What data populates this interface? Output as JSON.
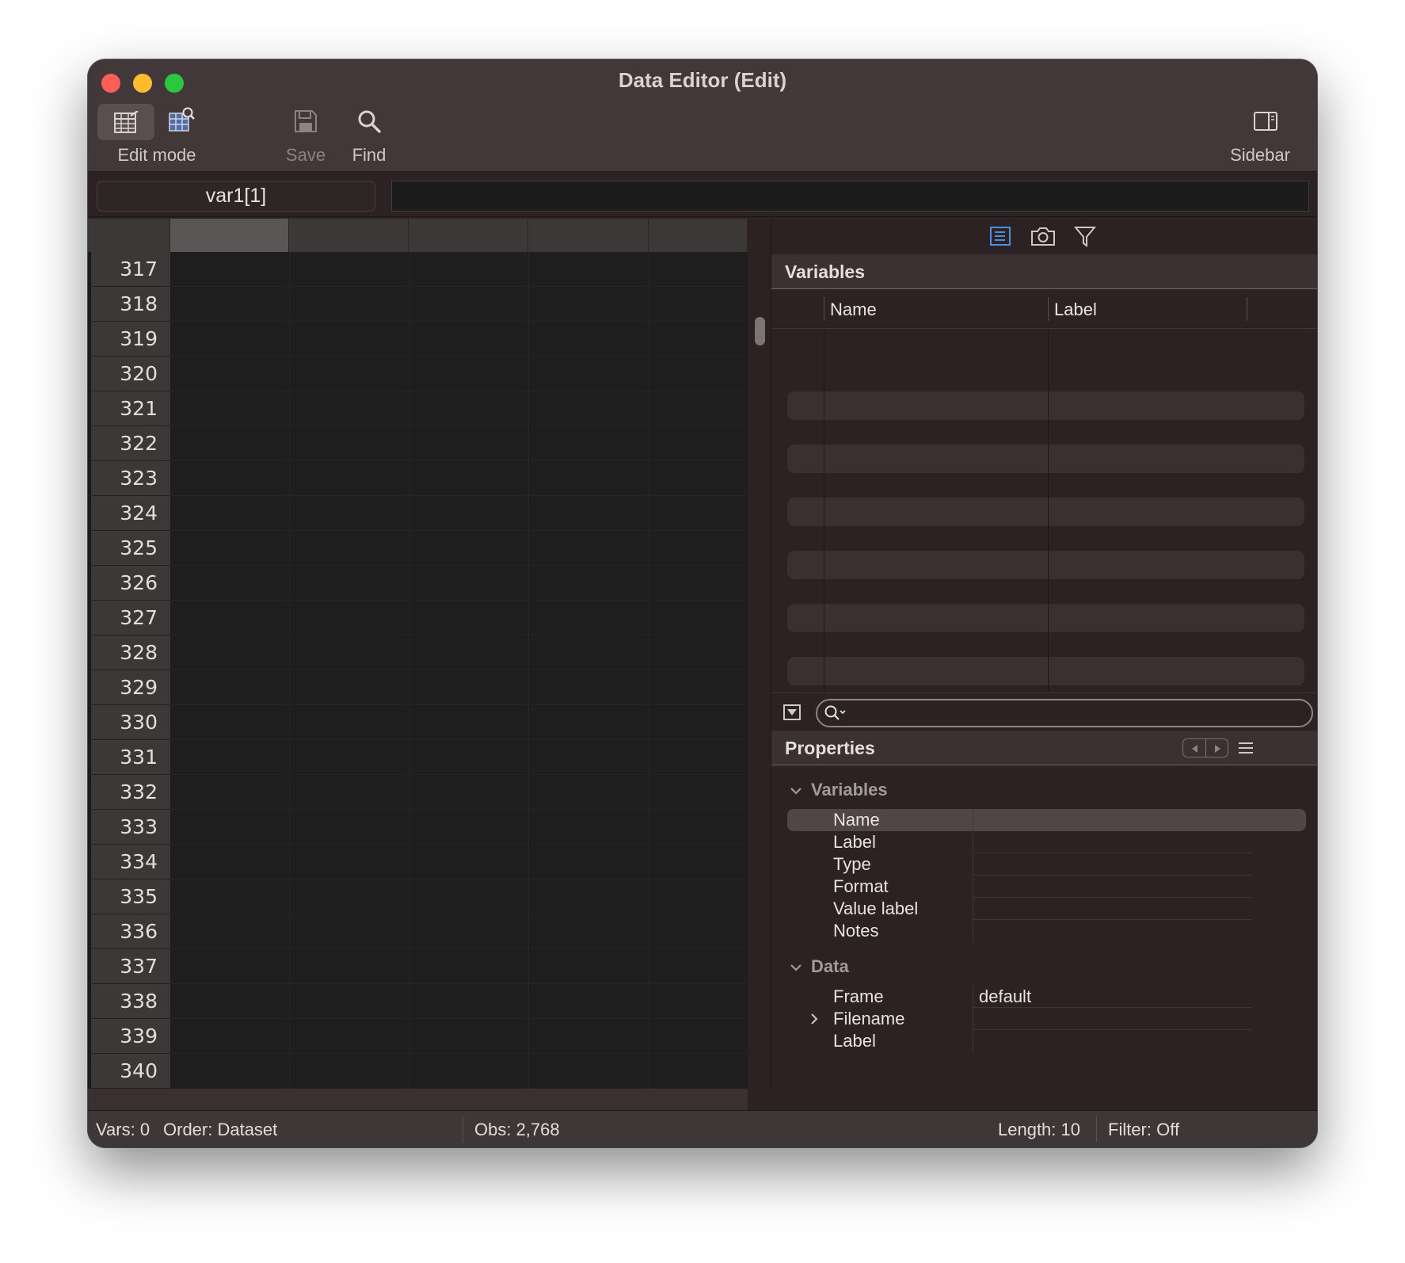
{
  "window": {
    "title": "Data Editor (Edit)"
  },
  "toolbar": {
    "edit_mode_label": "Edit mode",
    "save_label": "Save",
    "find_label": "Find",
    "sidebar_label": "Sidebar",
    "icons": [
      "table-edit-icon",
      "table-browse-icon",
      "save-icon",
      "search-icon",
      "sidebar-icon"
    ]
  },
  "address_bar": {
    "cell_ref": "var1[1]",
    "value": ""
  },
  "grid": {
    "row_numbers": [
      "317",
      "318",
      "319",
      "320",
      "321",
      "322",
      "323",
      "324",
      "325",
      "326",
      "327",
      "328",
      "329",
      "330",
      "331",
      "332",
      "333",
      "334",
      "335",
      "336",
      "337",
      "338",
      "339",
      "340"
    ]
  },
  "variables_panel": {
    "title": "Variables",
    "columns": [
      "Name",
      "Label"
    ],
    "tab_icons": [
      "variables-list-icon",
      "snapshot-camera-icon",
      "filter-icon"
    ],
    "search_placeholder": ""
  },
  "properties_panel": {
    "title": "Properties",
    "variables_group": {
      "label": "Variables",
      "rows": [
        {
          "key": "Name",
          "value": ""
        },
        {
          "key": "Label",
          "value": ""
        },
        {
          "key": "Type",
          "value": ""
        },
        {
          "key": "Format",
          "value": ""
        },
        {
          "key": "Value label",
          "value": ""
        },
        {
          "key": "Notes",
          "value": ""
        }
      ]
    },
    "data_group": {
      "label": "Data",
      "rows": [
        {
          "key": "Frame",
          "value": "default"
        },
        {
          "key": "Filename",
          "value": ""
        },
        {
          "key": "Label",
          "value": ""
        }
      ]
    }
  },
  "status_bar": {
    "vars": "Vars: 0",
    "order": "Order: Dataset",
    "obs": "Obs: 2,768",
    "length": "Length: 10",
    "filter": "Filter: Off"
  },
  "colors": {
    "accent": "#4a90e2",
    "close": "#fe5f57",
    "minimize": "#febc2e",
    "maximize": "#28c840"
  }
}
